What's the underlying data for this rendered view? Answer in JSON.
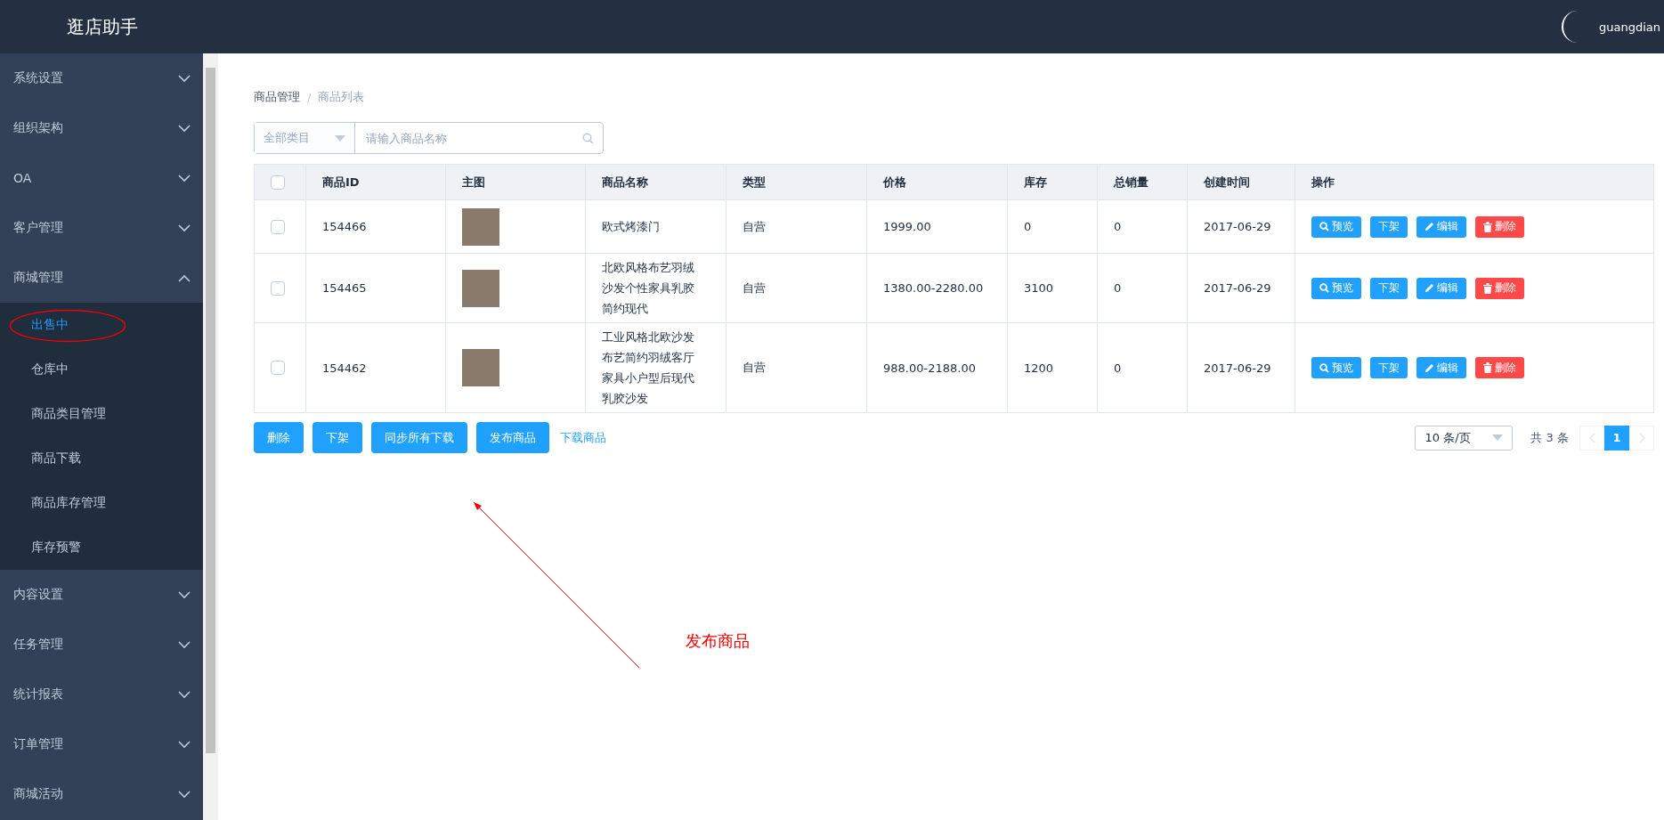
{
  "header": {
    "title": "逛店助手",
    "user": "guangdian"
  },
  "sidebar": {
    "items": [
      {
        "label": "系统设置",
        "expanded": false
      },
      {
        "label": "组织架构",
        "expanded": false
      },
      {
        "label": "OA",
        "expanded": false
      },
      {
        "label": "客户管理",
        "expanded": false
      },
      {
        "label": "商城管理",
        "expanded": true,
        "children": [
          {
            "label": "出售中",
            "selected": true,
            "circled": true
          },
          {
            "label": "仓库中",
            "selected": false,
            "circled": false
          },
          {
            "label": "商品类目管理",
            "selected": false,
            "circled": false
          },
          {
            "label": "商品下载",
            "selected": false,
            "circled": false
          },
          {
            "label": "商品库存管理",
            "selected": false,
            "circled": false
          },
          {
            "label": "库存预警",
            "selected": false,
            "circled": false
          }
        ]
      },
      {
        "label": "内容设置",
        "expanded": false
      },
      {
        "label": "任务管理",
        "expanded": false
      },
      {
        "label": "统计报表",
        "expanded": false
      },
      {
        "label": "订单管理",
        "expanded": false
      },
      {
        "label": "商城活动",
        "expanded": false
      }
    ]
  },
  "breadcrumb": {
    "separator": "/",
    "items": [
      "商品管理",
      "商品列表"
    ]
  },
  "search": {
    "category": "全部类目",
    "placeholder": "请输入商品名称"
  },
  "table": {
    "select_all_checked": false,
    "columns": [
      "商品ID",
      "主图",
      "商品名称",
      "类型",
      "价格",
      "库存",
      "总销量",
      "创建时间",
      "操作"
    ],
    "rows": [
      {
        "checked": false,
        "id": "154466",
        "name": "欧式烤漆门",
        "type": "自营",
        "price": "1999.00",
        "stock": "0",
        "sales": "0",
        "created": "2017-06-29",
        "actions": [
          {
            "kind": "preview",
            "label": "预览"
          },
          {
            "kind": "unlist",
            "label": "下架"
          },
          {
            "kind": "edit",
            "label": "编辑"
          },
          {
            "kind": "delete",
            "label": "删除"
          }
        ]
      },
      {
        "checked": false,
        "id": "154465",
        "name": "北欧风格布艺羽绒沙发个性家具乳胶简约现代",
        "type": "自营",
        "price": "1380.00-2280.00",
        "stock": "3100",
        "sales": "0",
        "created": "2017-06-29",
        "actions": [
          {
            "kind": "preview",
            "label": "预览"
          },
          {
            "kind": "unlist",
            "label": "下架"
          },
          {
            "kind": "edit",
            "label": "编辑"
          },
          {
            "kind": "delete",
            "label": "删除"
          }
        ]
      },
      {
        "checked": false,
        "id": "154462",
        "name": "工业风格北欧沙发布艺简约羽绒客厅家具小户型后现代乳胶沙发",
        "type": "自营",
        "price": "988.00-2188.00",
        "stock": "1200",
        "sales": "0",
        "created": "2017-06-29",
        "actions": [
          {
            "kind": "preview",
            "label": "预览"
          },
          {
            "kind": "unlist",
            "label": "下架"
          },
          {
            "kind": "edit",
            "label": "编辑"
          },
          {
            "kind": "delete",
            "label": "删除"
          }
        ]
      }
    ]
  },
  "bulk_actions": [
    {
      "kind": "button",
      "label": "删除"
    },
    {
      "kind": "button",
      "label": "下架"
    },
    {
      "kind": "button",
      "label": "同步所有下载"
    },
    {
      "kind": "button",
      "label": "发布商品"
    },
    {
      "kind": "link",
      "label": "下载商品"
    }
  ],
  "pagination": {
    "page_size": "10 条/页",
    "total": "共 3 条",
    "pages": [
      {
        "label": "1",
        "selected": true
      }
    ]
  },
  "annotation": {
    "text": "发布商品"
  }
}
